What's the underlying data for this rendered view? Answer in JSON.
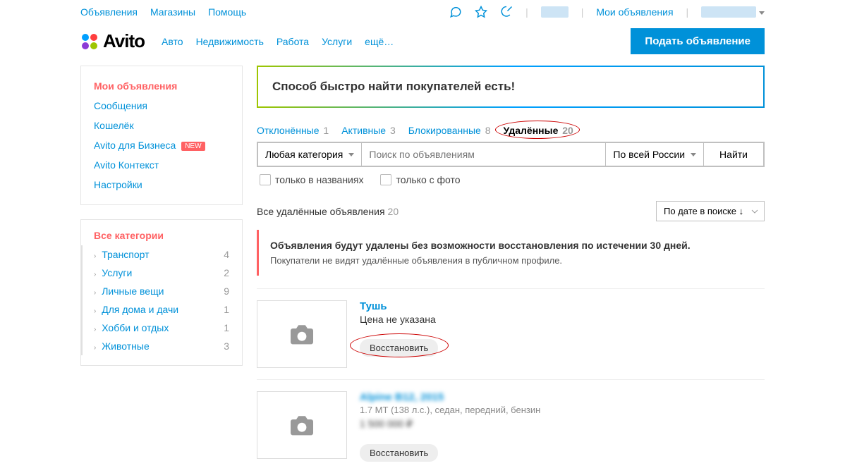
{
  "topbar": {
    "left": [
      "Объявления",
      "Магазины",
      "Помощь"
    ],
    "myads": "Мои объявления"
  },
  "logo_text": "Avito",
  "navcats": [
    "Авто",
    "Недвижимость",
    "Работа",
    "Услуги",
    "ещё…"
  ],
  "post_btn": "Подать объявление",
  "sidebar_menu": {
    "items": [
      {
        "label": "Мои объявления",
        "active": true
      },
      {
        "label": "Сообщения"
      },
      {
        "label": "Кошелёк"
      },
      {
        "label": "Avito для Бизнеса",
        "badge": "NEW"
      },
      {
        "label": "Avito Контекст"
      },
      {
        "label": "Настройки"
      }
    ]
  },
  "sidebar_cats": {
    "head": "Все категории",
    "items": [
      {
        "label": "Транспорт",
        "count": 4
      },
      {
        "label": "Услуги",
        "count": 2
      },
      {
        "label": "Личные вещи",
        "count": 9
      },
      {
        "label": "Для дома и дачи",
        "count": 1
      },
      {
        "label": "Хобби и отдых",
        "count": 1
      },
      {
        "label": "Животные",
        "count": 3
      }
    ]
  },
  "banner": "Способ быстро найти покупателей есть!",
  "tabs": [
    {
      "label": "Отклонённые",
      "count": 1
    },
    {
      "label": "Активные",
      "count": 3
    },
    {
      "label": "Блокированные",
      "count": 8
    },
    {
      "label": "Удалённые",
      "count": 20,
      "active": true
    }
  ],
  "search": {
    "category": "Любая категория",
    "placeholder": "Поиск по объявлениям",
    "region": "По всей России",
    "find": "Найти"
  },
  "filters": {
    "titles_only": "только в названиях",
    "with_photo": "только с фото"
  },
  "listhead": {
    "text": "Все удалённые объявления",
    "count": 20,
    "sort": "По дате в поиске ↓"
  },
  "warning": {
    "head": "Объявления будут удалены без возможности восстановления по истечении 30 дней.",
    "text": "Покупатели не видят удалённые объявления в публичном профиле."
  },
  "listings": [
    {
      "title": "Тушь",
      "price": "Цена не указана",
      "restore": "Восстановить"
    },
    {
      "title": "Alpine B12, 2015",
      "sub": "1.7 МТ (138 л.с.), седан, передний, бензин",
      "price": "1 500 000 ₽",
      "restore": "Восстановить",
      "blur": true
    }
  ]
}
